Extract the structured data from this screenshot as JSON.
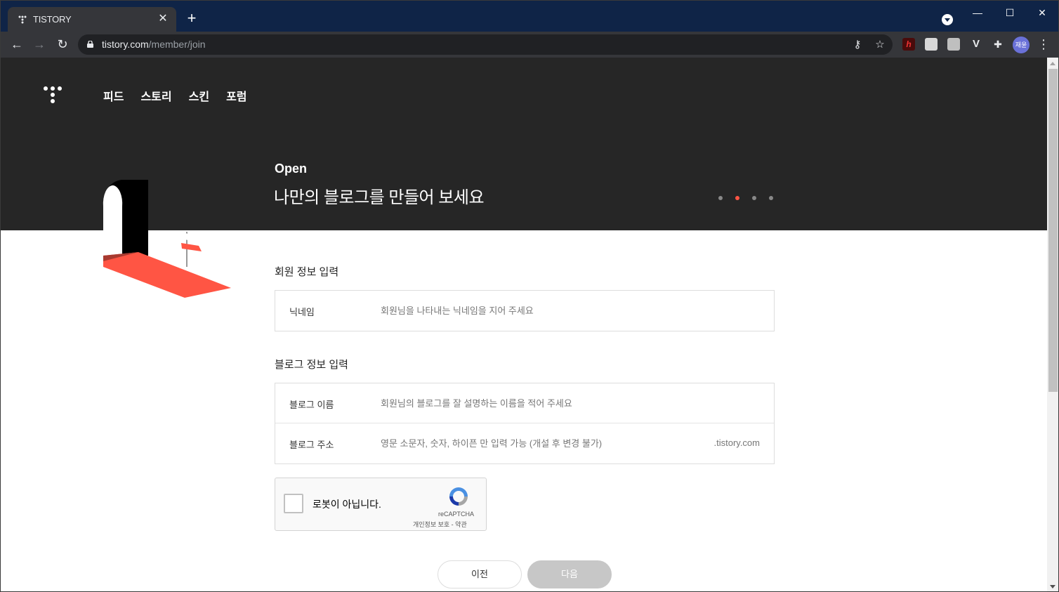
{
  "browser": {
    "tab_title": "TISTORY",
    "tab_close": "✕",
    "new_tab": "+",
    "url_host": "tistory.com",
    "url_path": "/member/join",
    "profile_initials": "재윤",
    "window_controls": {
      "minimize": "—",
      "maximize": "☐",
      "close": "✕"
    }
  },
  "header": {
    "nav": [
      "피드",
      "스토리",
      "스킨",
      "포럼"
    ]
  },
  "hero": {
    "kicker": "Open",
    "title": "나만의 블로그를 만들어 보세요",
    "carousel_active_index": 1,
    "carousel_count": 4,
    "accent_color": "#ff5544"
  },
  "member_section": {
    "title": "회원 정보 입력",
    "nickname_label": "닉네임",
    "nickname_placeholder": "회원님을 나타내는 닉네임을 지어 주세요"
  },
  "blog_section": {
    "title": "블로그 정보 입력",
    "name_label": "블로그 이름",
    "name_placeholder": "회원님의 블로그를 잘 설명하는 이름을 적어 주세요",
    "address_label": "블로그 주소",
    "address_placeholder": "영문 소문자, 숫자, 하이픈 만 입력 가능 (개설 후 변경 불가)",
    "address_suffix": ".tistory.com"
  },
  "captcha": {
    "label": "로봇이 아닙니다.",
    "brand": "reCAPTCHA",
    "links": "개인정보 보호 - 약관"
  },
  "buttons": {
    "prev": "이전",
    "next": "다음"
  }
}
